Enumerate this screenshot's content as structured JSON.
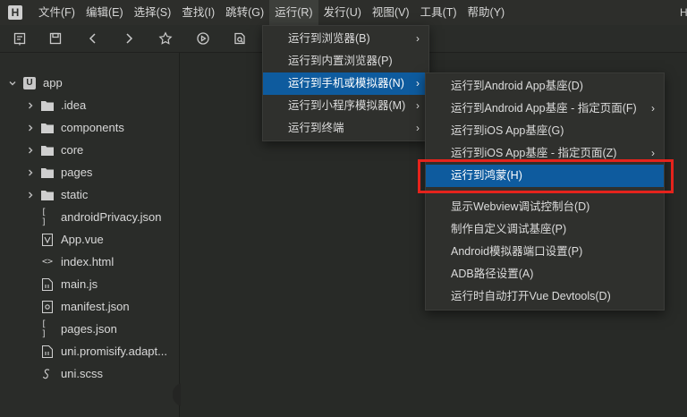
{
  "menubar": {
    "logo": "H",
    "items": [
      "文件(F)",
      "编辑(E)",
      "选择(S)",
      "查找(I)",
      "跳转(G)",
      "运行(R)",
      "发行(U)",
      "视图(V)",
      "工具(T)",
      "帮助(Y)"
    ],
    "trailing_text": "H"
  },
  "toolbar": {
    "icons": [
      "new-file-icon",
      "save-icon",
      "back-icon",
      "forward-icon",
      "star-icon",
      "run-icon",
      "preview-icon"
    ]
  },
  "sidebar": {
    "root": "app",
    "items": [
      {
        "label": ".idea",
        "type": "folder"
      },
      {
        "label": "components",
        "type": "folder"
      },
      {
        "label": "core",
        "type": "folder"
      },
      {
        "label": "pages",
        "type": "folder"
      },
      {
        "label": "static",
        "type": "folder"
      },
      {
        "label": "androidPrivacy.json",
        "type": "json"
      },
      {
        "label": "App.vue",
        "type": "vue"
      },
      {
        "label": "index.html",
        "type": "html"
      },
      {
        "label": "main.js",
        "type": "file"
      },
      {
        "label": "manifest.json",
        "type": "manifest"
      },
      {
        "label": "pages.json",
        "type": "json"
      },
      {
        "label": "uni.promisify.adapt...",
        "type": "file"
      },
      {
        "label": "uni.scss",
        "type": "scss"
      }
    ]
  },
  "run_menu": {
    "items": [
      {
        "label": "运行到浏览器(B)",
        "submenu": true
      },
      {
        "label": "运行到内置浏览器(P)",
        "submenu": false
      },
      {
        "label": "运行到手机或模拟器(N)",
        "submenu": true,
        "selected": true
      },
      {
        "label": "运行到小程序模拟器(M)",
        "submenu": true
      },
      {
        "label": "运行到终端",
        "submenu": true
      }
    ]
  },
  "device_submenu": {
    "items": [
      {
        "label": "运行到Android App基座(D)",
        "submenu": false
      },
      {
        "label": "运行到Android App基座 - 指定页面(F)",
        "submenu": true
      },
      {
        "label": "运行到iOS App基座(G)",
        "submenu": false
      },
      {
        "label": "运行到iOS App基座 - 指定页面(Z)",
        "submenu": true
      },
      {
        "label": "运行到鸿蒙(H)",
        "submenu": false,
        "selected": true
      },
      {
        "label": "显示Webview调试控制台(D)",
        "submenu": false
      },
      {
        "label": "制作自定义调试基座(P)",
        "submenu": false
      },
      {
        "label": "Android模拟器端口设置(P)",
        "submenu": false
      },
      {
        "label": "ADB路径设置(A)",
        "submenu": false
      },
      {
        "label": "运行时自动打开Vue Devtools(D)",
        "submenu": false
      }
    ]
  },
  "colors": {
    "selection": "#0e5b9e",
    "highlight_box": "#e5231c"
  }
}
